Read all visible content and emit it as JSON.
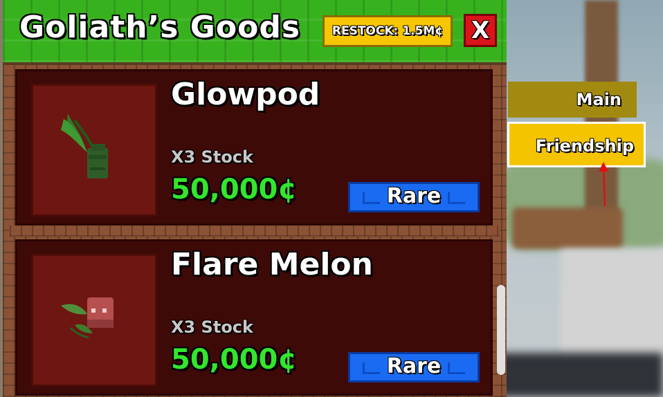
{
  "shop": {
    "title": "Goliath’s Goods",
    "restock_label": "RESTOCK: 1.5M¢",
    "close_label": "X"
  },
  "side_tabs": {
    "main": "Main",
    "friendship": "Friendship"
  },
  "items": [
    {
      "name": "Glowpod",
      "stock": "X3 Stock",
      "price": "50,000¢",
      "rarity": "Rare",
      "icon": "glowpod-seed-icon"
    },
    {
      "name": "Flare Melon",
      "stock": "X3 Stock",
      "price": "50,000¢",
      "rarity": "Rare",
      "icon": "flare-melon-seed-icon"
    }
  ],
  "colors": {
    "header_green": "#37b21e",
    "price_green": "#33e62d",
    "rare_blue": "#1a6bf2",
    "restock_yellow": "#f7c600",
    "close_red": "#d9151b",
    "friendship_tab": "#f5c400",
    "main_tab": "#a28a10"
  }
}
